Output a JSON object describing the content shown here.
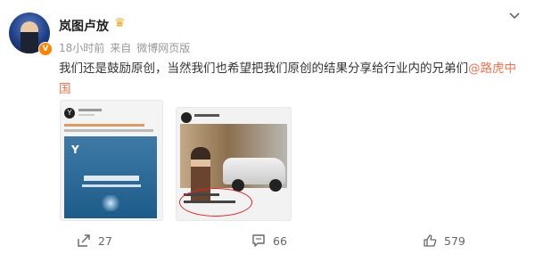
{
  "header": {
    "username": "岚图卢放",
    "time": "18小时前",
    "source": "来自",
    "client": "微博网页版",
    "verified_badge": "V"
  },
  "post": {
    "text": "我们还是鼓励原创，当然我们也希望把我们原创的结果分享给行业内的兄弟们",
    "mention": "@路虎中国"
  },
  "images": [
    {
      "icon": "app-screenshot-image",
      "logo_char": "Y"
    },
    {
      "icon": "photo-screenshot-image"
    }
  ],
  "actions": {
    "repost_count": "27",
    "comment_count": "66",
    "like_count": "579"
  },
  "icons": {
    "more": "chevron-down-icon",
    "repost": "share-icon",
    "comment": "comment-icon",
    "like": "thumbs-up-icon"
  },
  "colors": {
    "mention": "#eb7350",
    "badge": "#ff8200"
  }
}
